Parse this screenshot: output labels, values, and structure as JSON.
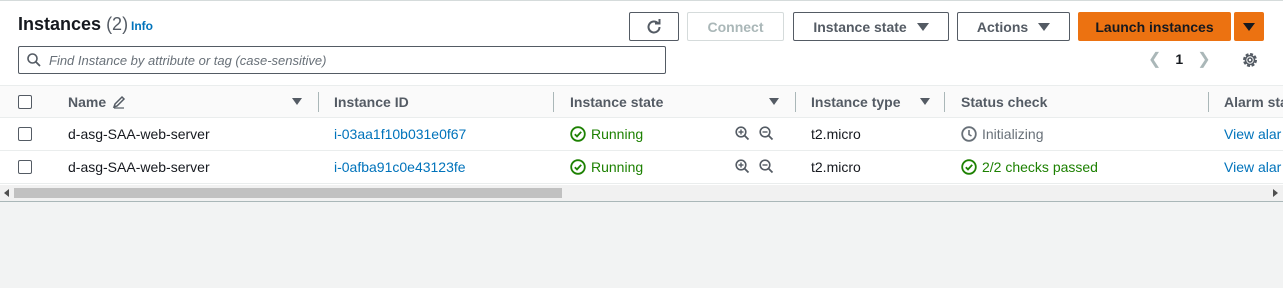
{
  "header": {
    "title": "Instances",
    "count": "(2)",
    "info": "Info"
  },
  "toolbar": {
    "connect": "Connect",
    "instance_state": "Instance state",
    "actions": "Actions",
    "launch": "Launch instances"
  },
  "search": {
    "placeholder": "Find Instance by attribute or tag (case-sensitive)"
  },
  "pagination": {
    "current_page": "1"
  },
  "table": {
    "columns": {
      "name": "Name",
      "instance_id": "Instance ID",
      "instance_state": "Instance state",
      "instance_type": "Instance type",
      "status_check": "Status check",
      "alarm_status": "Alarm sta"
    },
    "rows": [
      {
        "name": "d-asg-SAA-web-server",
        "instance_id": "i-03aa1f10b031e0f67",
        "state": "Running",
        "type": "t2.micro",
        "status": "Initializing",
        "alarm": "View alar"
      },
      {
        "name": "d-asg-SAA-web-server",
        "instance_id": "i-0afba91c0e43123fe",
        "state": "Running",
        "type": "t2.micro",
        "status": "2/2 checks passed",
        "alarm": "View alar"
      }
    ]
  },
  "colors": {
    "primary": "#ec7211",
    "link": "#0073bb",
    "success": "#1d8102"
  }
}
